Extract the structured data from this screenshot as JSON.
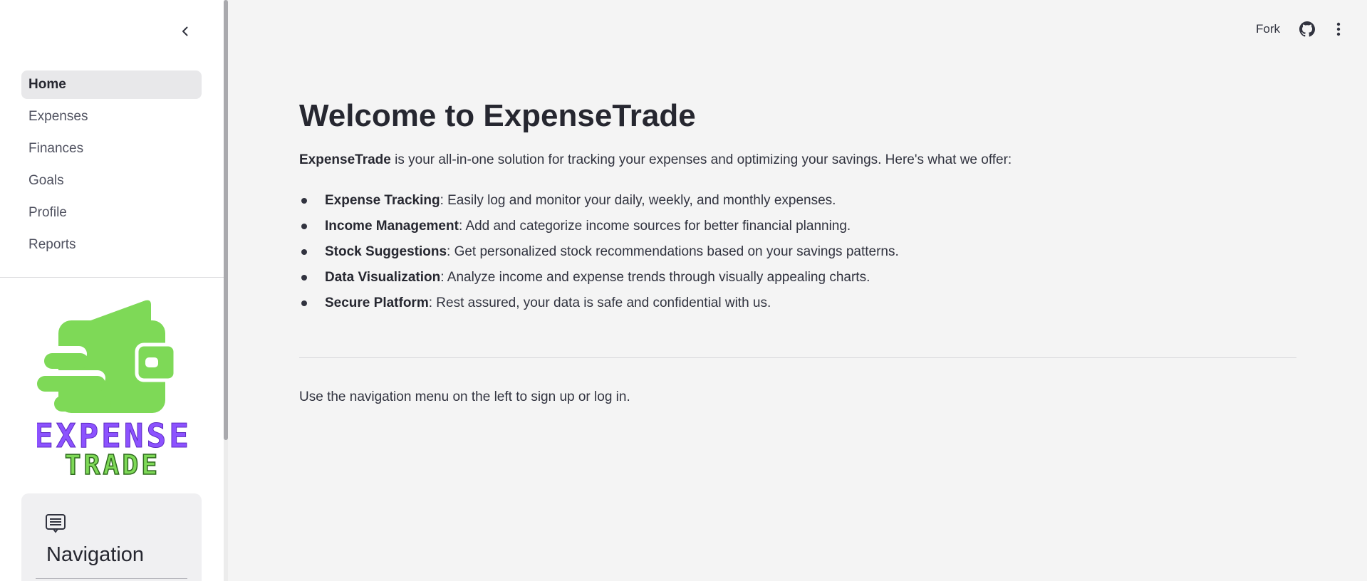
{
  "sidebar": {
    "nav_items": [
      {
        "label": "Home",
        "active": true
      },
      {
        "label": "Expenses",
        "active": false
      },
      {
        "label": "Finances",
        "active": false
      },
      {
        "label": "Goals",
        "active": false
      },
      {
        "label": "Profile",
        "active": false
      },
      {
        "label": "Reports",
        "active": false
      }
    ],
    "logo": {
      "line1": "EXPENSE",
      "line2": "TRADE",
      "green": "#7ed957",
      "purple": "#8c52ff"
    },
    "nav_card": {
      "icon": "menu-list-icon",
      "title": "Navigation"
    }
  },
  "toolbar": {
    "fork_label": "Fork",
    "github_icon": "github-icon",
    "menu_icon": "more-vertical-icon"
  },
  "main": {
    "title": "Welcome to ExpenseTrade",
    "intro_brand": "ExpenseTrade",
    "intro_text": " is your all-in-one solution for tracking your expenses and optimizing your savings. Here's what we offer:",
    "features": [
      {
        "name": "Expense Tracking",
        "desc": ": Easily log and monitor your daily, weekly, and monthly expenses."
      },
      {
        "name": "Income Management",
        "desc": ": Add and categorize income sources for better financial planning."
      },
      {
        "name": "Stock Suggestions",
        "desc": ": Get personalized stock recommendations based on your savings patterns."
      },
      {
        "name": "Data Visualization",
        "desc": ": Analyze income and expense trends through visually appealing charts."
      },
      {
        "name": "Secure Platform",
        "desc": ": Rest assured, your data is safe and confidential with us."
      }
    ],
    "footer_note": "Use the navigation menu on the left to sign up or log in."
  },
  "colors": {
    "background": "#f4f4f4",
    "sidebar": "#ffffff",
    "active_nav": "#e8e8ea",
    "text": "#31333f"
  }
}
